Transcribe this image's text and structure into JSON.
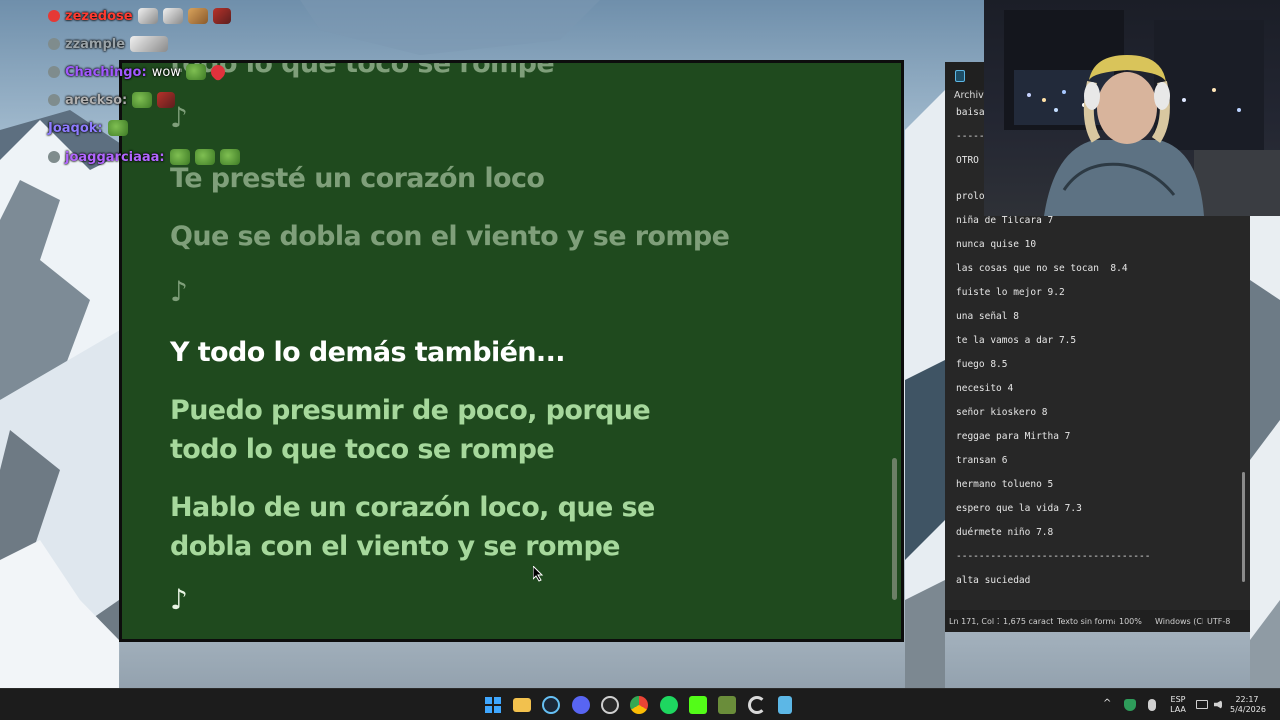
{
  "chat": [
    {
      "user": "zezedose",
      "color": "#ff3b30",
      "badge": "#e53935",
      "message": "",
      "emotes": [
        "face",
        "face",
        "cat",
        "guitar"
      ]
    },
    {
      "user": "zzample",
      "color": "#9aa3a8",
      "badge": "#7f8c8d",
      "message": "",
      "emotes": [
        "face"
      ]
    },
    {
      "user": "Chachingo:",
      "color": "#a259ff",
      "badge": "#7f8c8d",
      "message": "wow",
      "emotes": [
        "frog",
        "heart"
      ]
    },
    {
      "user": "areckso:",
      "color": "#b0b0b0",
      "badge": "#7f8c8d",
      "message": "",
      "emotes": [
        "frog",
        "guitar"
      ]
    },
    {
      "user": "Joaqok:",
      "color": "#8e7cff",
      "badge": "",
      "message": "",
      "emotes": [
        "frog"
      ]
    },
    {
      "user": "joaggarciaaa:",
      "color": "#b266ff",
      "badge": "#7f8c8d",
      "message": "",
      "emotes": [
        "frog",
        "frog",
        "frog"
      ]
    }
  ],
  "lyrics": {
    "lines": [
      {
        "text": "todo lo que toco se rompe",
        "state": "past"
      },
      {
        "text": "Te presté un corazón loco",
        "state": "past"
      },
      {
        "text": "Que se dobla con el viento y se rompe",
        "state": "past"
      },
      {
        "text": "Y todo lo demás también...",
        "state": "current"
      },
      {
        "text": "Puedo presumir de poco, porque\ntodo lo que toco se rompe",
        "state": "future"
      },
      {
        "text": "Hablo de un corazón loco, que se\ndobla con el viento y se rompe",
        "state": "future"
      }
    ],
    "note_symbol": "♪"
  },
  "notepad": {
    "menu": "Archivo",
    "lines": [
      "baisa",
      "-----",
      "OTRO I",
      "",
      "prolo",
      "niña de Tilcara 7",
      "nunca quise 10",
      "las cosas que no se tocan  8.4",
      "fuiste lo mejor 9.2",
      "una señal 8",
      "te la vamos a dar 7.5",
      "fuego 8.5",
      "necesito 4",
      "señor kioskero 8",
      "reggae para Mirtha 7",
      "transan 6",
      "hermano tolueno 5",
      "espero que la vida 7.3",
      "duérmete niño 7.8",
      "----------------------------------",
      "alta suciedad"
    ],
    "status": {
      "position": "Ln 171, Col 1",
      "chars": "1,675 caracteres",
      "format": "Texto sin formato",
      "zoom": "100%",
      "eol": "Windows (CRLF)",
      "encoding": "UTF-8"
    }
  },
  "tray": {
    "lang_top": "ESP",
    "lang_bottom": "LAA",
    "time": "22:17",
    "date": "5/4/2026"
  }
}
